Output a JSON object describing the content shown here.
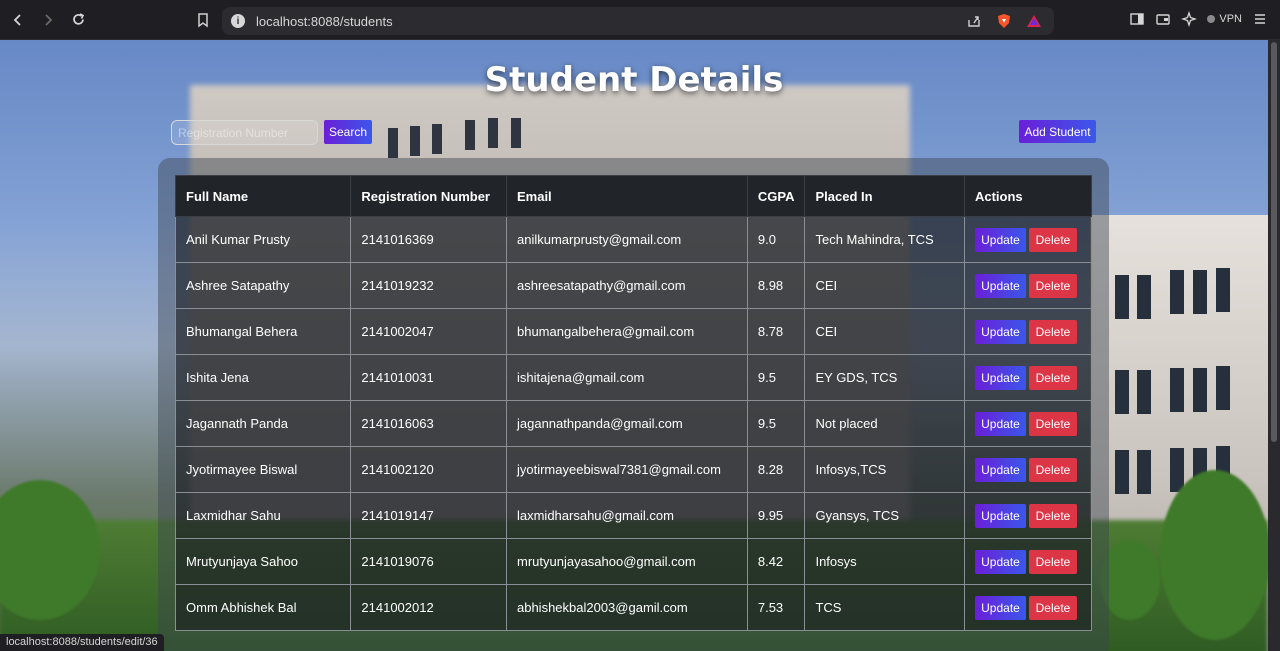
{
  "browser": {
    "url": "localhost:8088/students",
    "vpn_label": "VPN",
    "status_url": "localhost:8088/students/edit/36"
  },
  "page": {
    "title": "Student Details",
    "search": {
      "placeholder": "Registration Number",
      "button_label": "Search"
    },
    "add_button_label": "Add Student",
    "table": {
      "headers": [
        "Full Name",
        "Registration Number",
        "Email",
        "CGPA",
        "Placed In",
        "Actions"
      ],
      "rows": [
        {
          "name": "Anil Kumar Prusty",
          "reg": "2141016369",
          "email": "anilkumarprusty@gmail.com",
          "cgpa": "9.0",
          "placed": "Tech Mahindra, TCS"
        },
        {
          "name": "Ashree Satapathy",
          "reg": "2141019232",
          "email": "ashreesatapathy@gmail.com",
          "cgpa": "8.98",
          "placed": "CEI"
        },
        {
          "name": "Bhumangal Behera",
          "reg": "2141002047",
          "email": "bhumangalbehera@gmail.com",
          "cgpa": "8.78",
          "placed": "CEI"
        },
        {
          "name": "Ishita Jena",
          "reg": "2141010031",
          "email": "ishitajena@gmail.com",
          "cgpa": "9.5",
          "placed": "EY GDS, TCS"
        },
        {
          "name": "Jagannath Panda",
          "reg": "2141016063",
          "email": "jagannathpanda@gmail.com",
          "cgpa": "9.5",
          "placed": "Not placed"
        },
        {
          "name": "Jyotirmayee Biswal",
          "reg": "2141002120",
          "email": "jyotirmayeebiswal7381@gmail.com",
          "cgpa": "8.28",
          "placed": "Infosys,TCS"
        },
        {
          "name": "Laxmidhar Sahu",
          "reg": "2141019147",
          "email": "laxmidharsahu@gmail.com",
          "cgpa": "9.95",
          "placed": "Gyansys, TCS"
        },
        {
          "name": "Mrutyunjaya Sahoo",
          "reg": "2141019076",
          "email": "mrutyunjayasahoo@gmail.com",
          "cgpa": "8.42",
          "placed": "Infosys"
        },
        {
          "name": "Omm Abhishek Bal",
          "reg": "2141002012",
          "email": "abhishekbal2003@gamil.com",
          "cgpa": "7.53",
          "placed": "TCS"
        }
      ],
      "update_label": "Update",
      "delete_label": "Delete"
    }
  },
  "colors": {
    "accent_gradient_start": "#6a1fd8",
    "accent_gradient_end": "#3b57ea",
    "delete": "#dc3545",
    "table_header": "#212529"
  }
}
